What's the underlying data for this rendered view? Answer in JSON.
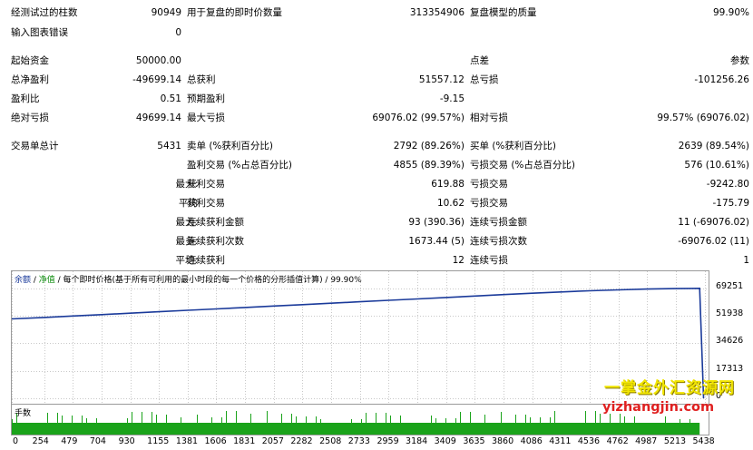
{
  "stats": {
    "rows": [
      {
        "c1": "经测试过的柱数",
        "v1": "90949",
        "l2": "用于复盘的即时价数量",
        "v2": "313354906",
        "l3": "复盘模型的质量",
        "v3": "99.90%"
      },
      {
        "c1": "输入图表错误",
        "v1": "0",
        "l2": "",
        "v2": "",
        "l3": "",
        "v3": ""
      },
      {
        "c1": "起始资金",
        "v1": "50000.00",
        "l2": "",
        "v2": "",
        "l3": "点差",
        "v3": "参数"
      },
      {
        "c1": "总净盈利",
        "v1": "-49699.14",
        "l2": "总获利",
        "v2": "51557.12",
        "l3": "总亏损",
        "v3": "-101256.26"
      },
      {
        "c1": "盈利比",
        "v1": "0.51",
        "l2": "预期盈利",
        "v2": "-9.15",
        "l3": "",
        "v3": ""
      },
      {
        "c1": "绝对亏损",
        "v1": "49699.14",
        "l2": "最大亏损",
        "v2": "69076.02 (99.57%)",
        "l3": "相对亏损",
        "v3": "99.57% (69076.02)"
      },
      {
        "c1": "交易单总计",
        "v1": "5431",
        "l2": "卖单 (%获利百分比)",
        "v2": "2792 (89.26%)",
        "l3": "买单 (%获利百分比)",
        "v3": "2639 (89.54%)"
      },
      {
        "c1": "",
        "v1": "",
        "l2": "盈利交易 (%占总百分比)",
        "v2": "4855 (89.39%)",
        "l3": "亏损交易 (%占总百分比)",
        "v3": "576 (10.61%)"
      },
      {
        "c1": "",
        "v1": "",
        "pre": "最大:",
        "l2": "获利交易",
        "v2": "619.88",
        "l3": "亏损交易",
        "v3": "-9242.80"
      },
      {
        "c1": "",
        "v1": "",
        "pre": "平均",
        "l2": "获利交易",
        "v2": "10.62",
        "l3": "亏损交易",
        "v3": "-175.79"
      },
      {
        "c1": "",
        "v1": "",
        "pre": "最大:",
        "l2": "连续获利金额",
        "v2": "93 (390.36)",
        "l3": "连续亏损金额",
        "v3": "11 (-69076.02)"
      },
      {
        "c1": "",
        "v1": "",
        "pre": "最多:",
        "l2": "连续获利次数",
        "v2": "1673.44 (5)",
        "l3": "连续亏损次数",
        "v3": "-69076.02 (11)"
      },
      {
        "c1": "",
        "v1": "",
        "pre": "平均:",
        "l2": "连续获利",
        "v2": "12",
        "l3": "连续亏损",
        "v3": "1"
      }
    ]
  },
  "chart": {
    "title_equity": "余额",
    "title_sep": " / ",
    "title_balance": "净值",
    "title_rest": " / 每个即时价格(基于所有可利用的最小时段的每一个价格的分形插值计算) / 99.90%",
    "volume_label": "手数",
    "colors": {
      "line": "#1a3a9a",
      "volume": "#1aa31a",
      "grid": "#c8c8c8"
    }
  },
  "chart_data": {
    "type": "line",
    "title": "",
    "x": [
      0,
      254,
      479,
      704,
      930,
      1155,
      1381,
      1606,
      1831,
      2057,
      2282,
      2508,
      2733,
      2959,
      3184,
      3409,
      3635,
      3860,
      4086,
      4311,
      4536,
      4762,
      4987,
      5213,
      5400,
      5431
    ],
    "series": [
      {
        "values": [
          50000,
          50900,
          51800,
          52700,
          53600,
          54500,
          55400,
          56300,
          57200,
          58100,
          59000,
          59900,
          60800,
          61700,
          62600,
          63500,
          64400,
          65300,
          66200,
          67000,
          67700,
          68300,
          68800,
          69100,
          69251,
          0
        ]
      }
    ],
    "xticks": [
      "0",
      "254",
      "479",
      "704",
      "930",
      "1155",
      "1381",
      "1606",
      "1831",
      "2057",
      "2282",
      "2508",
      "2733",
      "2959",
      "3184",
      "3409",
      "3635",
      "3860",
      "4086",
      "4311",
      "4536",
      "4762",
      "4987",
      "5213",
      "5438"
    ],
    "yticks": [
      "69251",
      "51938",
      "34626",
      "17313",
      "0"
    ],
    "ylim": [
      0,
      72000
    ],
    "xlim": [
      0,
      5470
    ],
    "grid": true
  },
  "watermark": {
    "line1": "一掌金外汇资源网",
    "line2": "yizhangjin.com"
  }
}
